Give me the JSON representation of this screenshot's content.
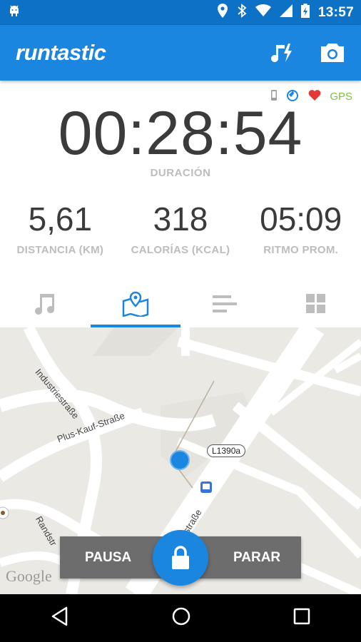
{
  "status_bar": {
    "time": "13:57"
  },
  "app_bar": {
    "logo": "runtastic"
  },
  "sensors": {
    "gps_label": "GPS"
  },
  "session": {
    "duration": "00:28:54",
    "duration_label": "DURACIÓN",
    "metrics": [
      {
        "value": "5,61",
        "label": "DISTANCIA (KM)"
      },
      {
        "value": "318",
        "label": "CALORÍAS (KCAL)"
      },
      {
        "value": "05:09",
        "label": "RITMO PROM."
      }
    ]
  },
  "tabs": [
    {
      "icon": "music-note-icon",
      "active": false
    },
    {
      "icon": "map-icon",
      "active": true
    },
    {
      "icon": "list-icon",
      "active": false
    },
    {
      "icon": "grid-icon",
      "active": false
    }
  ],
  "map": {
    "streets": [
      "Industriestraße",
      "Plus-Kauf-Straße",
      "Randstr",
      "alstraße"
    ],
    "road_badge": "L1390a",
    "attribution": "Google"
  },
  "controls": {
    "pause": "PAUSA",
    "stop": "PARAR"
  },
  "colors": {
    "primary": "#1a86e0",
    "status": "#0d72c6",
    "gps": "#7cc33f",
    "heart": "#e53935"
  }
}
